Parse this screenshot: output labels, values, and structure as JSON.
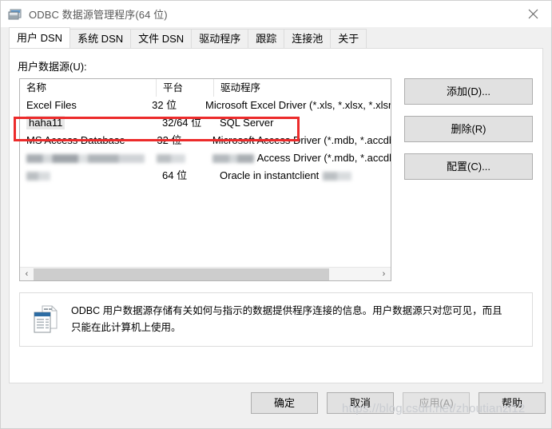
{
  "window": {
    "title": "ODBC 数据源管理程序(64 位)",
    "icon": "odbc-app-icon",
    "close_label": "✕"
  },
  "tabs": [
    {
      "label": "用户 DSN",
      "active": true
    },
    {
      "label": "系统 DSN",
      "active": false
    },
    {
      "label": "文件 DSN",
      "active": false
    },
    {
      "label": "驱动程序",
      "active": false
    },
    {
      "label": "跟踪",
      "active": false
    },
    {
      "label": "连接池",
      "active": false
    },
    {
      "label": "关于",
      "active": false
    }
  ],
  "main": {
    "list_label": "用户数据源(U):",
    "columns": [
      "名称",
      "平台",
      "驱动程序"
    ],
    "rows": [
      {
        "name": "Excel Files",
        "platform": "32 位",
        "driver": "Microsoft Excel Driver (*.xls, *.xlsx, *.xlsm, *",
        "selected": false,
        "redacted": "none"
      },
      {
        "name": "haha11",
        "platform": "32/64 位",
        "driver": "SQL Server",
        "selected": true,
        "redacted": "none"
      },
      {
        "name": "MS Access Database",
        "platform": "32 位",
        "driver": "Microsoft Access Driver (*.mdb, *.accdb)",
        "selected": false,
        "redacted": "none"
      },
      {
        "name": "",
        "platform": "",
        "driver": "Access Driver (*.mdb, *.accdb)",
        "selected": false,
        "redacted": "name-platform-driverprefix"
      },
      {
        "name": "",
        "platform": "64 位",
        "driver": "Oracle in instantclient",
        "selected": false,
        "redacted": "name-driversuffix"
      }
    ],
    "scrollbar": {
      "left_arrow": "‹",
      "right_arrow": "›"
    }
  },
  "side_buttons": [
    {
      "label": "添加(D)...",
      "name": "add-button"
    },
    {
      "label": "删除(R)",
      "name": "remove-button"
    },
    {
      "label": "配置(C)...",
      "name": "configure-button"
    }
  ],
  "info": {
    "icon": "data-source-document-icon",
    "text": "ODBC 用户数据源存储有关如何与指示的数据提供程序连接的信息。用户数据源只对您可见，而且只能在此计算机上使用。"
  },
  "bottom_buttons": {
    "ok": "确定",
    "cancel": "取消",
    "apply": "应用(A)",
    "help": "帮助"
  },
  "watermark": "https://blog.csdn.net/zhoutianzi12",
  "colors": {
    "highlight": "#ec2b2b",
    "dialog_bg": "#f0f0f0",
    "button_bg": "#e1e1e1",
    "selection": "#e8e8e8"
  }
}
